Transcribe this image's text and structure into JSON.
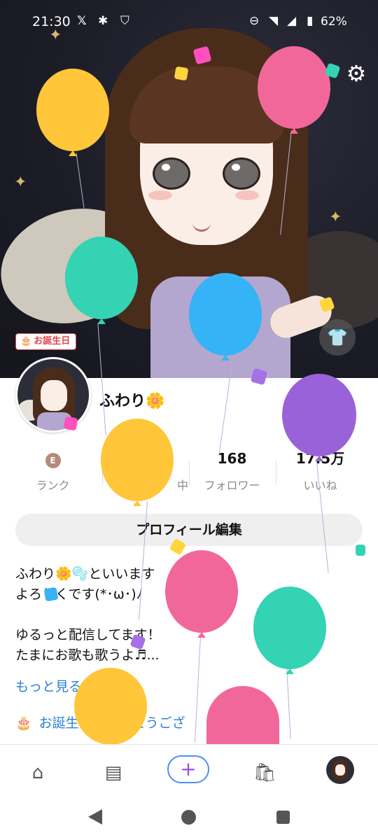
{
  "status_bar": {
    "time": "21:30",
    "icons": [
      "x-icon",
      "bug-icon",
      "shield-icon",
      "minus-circle-icon",
      "wifi-icon",
      "signal-icon",
      "battery-icon"
    ],
    "battery": "62%"
  },
  "header": {
    "settings_icon": "gear-icon",
    "outfit_icon": "shirt-icon",
    "birthday_badge": "お誕生日"
  },
  "profile": {
    "name": "ふわり",
    "name_emoji": "🌼",
    "stats": [
      {
        "value": "",
        "label": "ランク"
      },
      {
        "value": "",
        "label": "中"
      },
      {
        "value": "168",
        "label": "フォロワー"
      },
      {
        "value": "17.5万",
        "label": "いいね"
      }
    ],
    "rank_medal": "E",
    "edit_button": "プロフィール編集",
    "bio_lines": [
      "ふわり🌼🫧といいます",
      "よろしくです(*･ω･)ﾉ",
      "",
      "ゆるっと配信してます！",
      "たまにお歌も歌うよ♬..."
    ],
    "more_link": "もっと見る",
    "birthday_line": "お誕生日おめでとうござ"
  },
  "bottom_nav": {
    "items": [
      "home-icon",
      "feed-icon",
      "create-icon",
      "shop-icon",
      "profile-icon"
    ],
    "plus": "+"
  },
  "colors": {
    "accent_blue": "#2a7fd4",
    "badge_red": "#e0464c",
    "balloon_yellow": "#ffc63a",
    "balloon_pink": "#f2679a",
    "balloon_teal": "#33d3b4",
    "balloon_blue": "#34b3f6",
    "balloon_purple": "#9a62d8"
  }
}
